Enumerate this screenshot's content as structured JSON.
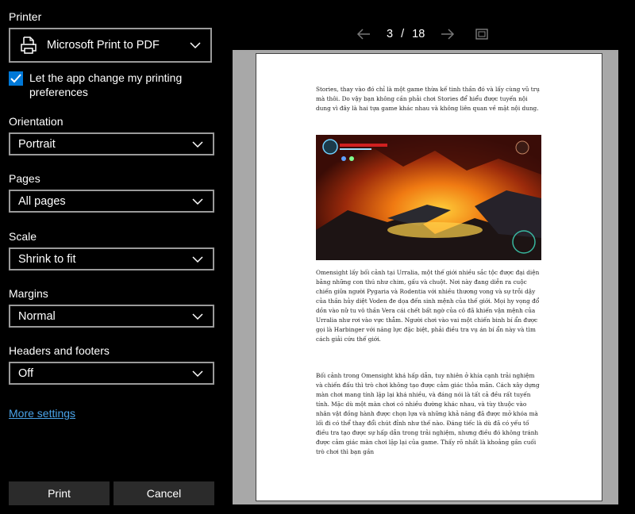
{
  "printer": {
    "label": "Printer",
    "selected": "Microsoft Print to PDF"
  },
  "preferences_checkbox": {
    "label": "Let the app change my printing preferences",
    "checked": true
  },
  "orientation": {
    "label": "Orientation",
    "value": "Portrait"
  },
  "pages": {
    "label": "Pages",
    "value": "All pages"
  },
  "scale": {
    "label": "Scale",
    "value": "Shrink to fit"
  },
  "margins": {
    "label": "Margins",
    "value": "Normal"
  },
  "headers_footers": {
    "label": "Headers and footers",
    "value": "Off"
  },
  "more_settings": "More settings",
  "buttons": {
    "print": "Print",
    "cancel": "Cancel"
  },
  "preview_nav": {
    "current_page": "3",
    "separator": "/",
    "total_pages": "18"
  },
  "preview": {
    "para1": "Stories, thay vào đó chỉ là một game thừa kế tinh thần đó và lấy cùng vũ trụ mà thôi. Do vậy bạn không cần phải chơi Stories để hiểu được tuyến nội dung vì đây là hai tựa game khác nhau và không liên quan về mặt nội dung.",
    "para2": "Omensight lấy bối cảnh tại Urralia, một thế giới nhiều sắc tộc được đại diện bằng những con thú như chim, gấu và chuột. Nơi này đang diễn ra cuộc chiến giữa người Pygaria và Rodentia với nhiều thương vong và sự trỗi dậy của thần hủy diệt Voden đe dọa đến sinh mệnh của thế giới. Mọi hy vọng đổ dồn vào nữ tu vô thần Vera cái chết bất ngờ của cô đã khiến vận mệnh của Urralia như rơi vào vực thẳm. Người chơi vào vai một chiến binh bí ẩn được gọi là Harbinger với năng lực đặc biệt, phải điều tra vụ án bí ẩn này và tìm cách giải cứu thế giới.",
    "para3": "Bối cảnh trong Omensight khá hấp dẫn, tuy nhiên ở khía cạnh trải nghiệm và chiến đấu thì trò chơi không tạo được cảm giác thỏa mãn. Cách xây dựng màn chơi mang tính lặp lại khá nhiều, và đáng nói là tất cả đều rất tuyến tính. Mặc dù một màn chơi có nhiều đường khác nhau, và tùy thuộc vào nhân vật đồng hành được chọn lựa và những khả năng đã được mở khóa mà lối đi có thể thay đổi chút đỉnh như thế nào. Đáng tiếc là dù đã có yếu tố điều tra tạo được sự hấp dẫn trong trải nghiệm, nhưng điều đó không tránh được cảm giác màn chơi lặp lại của game. Thấy rõ nhất là khoảng gần cuối trò chơi thì bạn gần"
  },
  "colors": {
    "accent": "#0078d7",
    "link": "#4aa3e8",
    "button_bg": "#2b2b2b",
    "select_border": "#9a9a9a"
  }
}
